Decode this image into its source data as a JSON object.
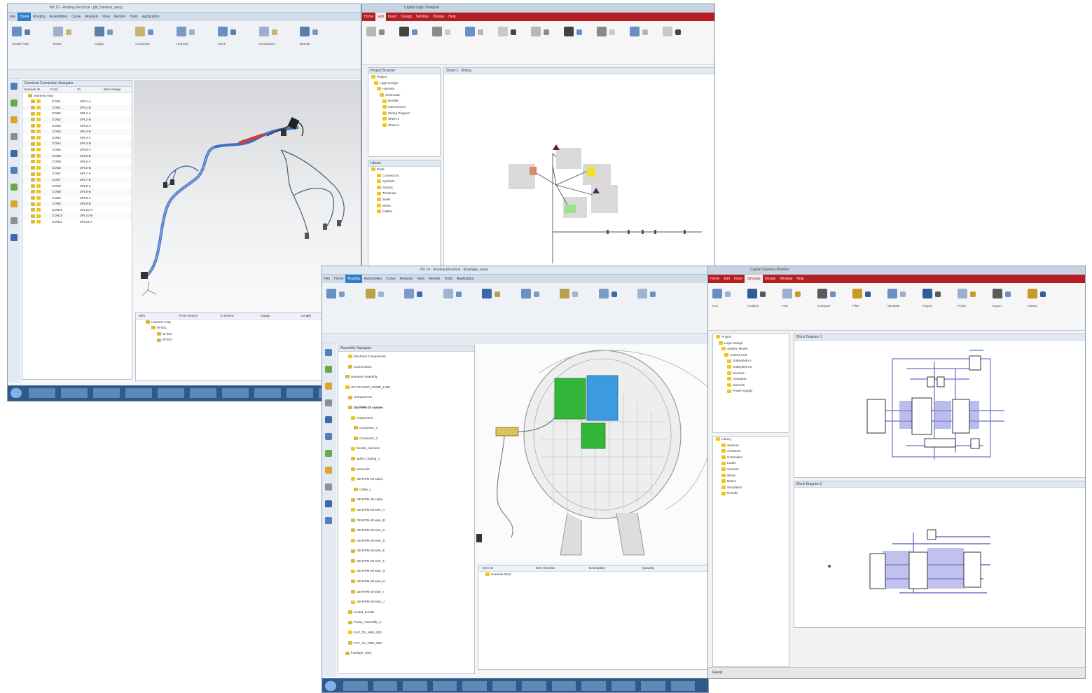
{
  "window1": {
    "title": "NX 10 - Routing Electrical - [db_harness_assy]",
    "tabs": [
      "File",
      "Home",
      "Routing",
      "Assemblies",
      "Curve",
      "Analysis",
      "View",
      "Render",
      "Tools",
      "Application"
    ],
    "active_tab": "Home",
    "ribbon_labels": [
      "Create Path",
      "Route",
      "Assign",
      "Connector",
      "Harness",
      "Stock",
      "Component",
      "Bundle"
    ],
    "navigator": {
      "title": "Electrical Connection Navigator",
      "columns": [
        "Harness ID",
        "From",
        "To",
        "Wire Gauge"
      ],
      "root": "Harness Assy",
      "rows": [
        {
          "from": "CON1",
          "to": "SPL1-A"
        },
        {
          "from": "CON1",
          "to": "SPL1-B"
        },
        {
          "from": "CON2",
          "to": "SPL2-A"
        },
        {
          "from": "CON2",
          "to": "SPL2-B"
        },
        {
          "from": "CON3",
          "to": "SPL3-A"
        },
        {
          "from": "CON3",
          "to": "SPL3-B"
        },
        {
          "from": "CON4",
          "to": "SPL4-A"
        },
        {
          "from": "CON4",
          "to": "SPL4-B"
        },
        {
          "from": "CON5",
          "to": "SPL5-A"
        },
        {
          "from": "CON5",
          "to": "SPL5-B"
        },
        {
          "from": "CON6",
          "to": "SPL6-A"
        },
        {
          "from": "CON6",
          "to": "SPL6-B"
        },
        {
          "from": "CON7",
          "to": "SPL7-A"
        },
        {
          "from": "CON7",
          "to": "SPL7-B"
        },
        {
          "from": "CON8",
          "to": "SPL8-A"
        },
        {
          "from": "CON8",
          "to": "SPL8-B"
        },
        {
          "from": "CON9",
          "to": "SPL9-A"
        },
        {
          "from": "CON9",
          "to": "SPL9-B"
        },
        {
          "from": "CON10",
          "to": "SPL10-A"
        },
        {
          "from": "CON10",
          "to": "SPL10-B"
        },
        {
          "from": "CON11",
          "to": "SPL11-A"
        }
      ]
    },
    "bottom_panel": {
      "columns": [
        "Wire",
        "From Device",
        "To Device",
        "Gauge",
        "Length"
      ],
      "rows": [
        "Harness Assy",
        "W-001",
        "W-002",
        "W-003"
      ]
    }
  },
  "window2": {
    "title": "Capital Logic Designer",
    "tabs": [
      "Home",
      "Edit",
      "Insert",
      "Design",
      "Window",
      "Display",
      "Help"
    ],
    "active_tab": "Edit",
    "tree_title": "Project Browser",
    "tree_items": [
      "Project",
      "Logic Design",
      "Harness",
      "Schematic",
      "Bundle",
      "Interconnect",
      "Wiring Diagram",
      "Sheet 1",
      "Sheet 2"
    ],
    "tree2_title": "Library",
    "tree2_items": [
      "Parts",
      "Connectors",
      "Symbols",
      "Splices",
      "Terminals",
      "Seals",
      "Wires",
      "Cables"
    ],
    "canvas_title": "Sheet 1 - Wiring"
  },
  "window3": {
    "title": "NX 10 - Routing Electrical - [fuselage_assy]",
    "tabs": [
      "File",
      "Home",
      "Routing",
      "Assemblies",
      "Curve",
      "Analysis",
      "View",
      "Render",
      "Tools",
      "Application"
    ],
    "active_tab": "Routing",
    "navigator": {
      "title": "Assembly Navigator",
      "rows": [
        "Electrical Components",
        "Connections",
        "Harness Assembly",
        "HFT-RH-EXT_PUMP_LINE",
        "Components",
        "GE-RPM-20 system",
        "Connectors",
        "Connector_1",
        "Connector_2",
        "bundle_harness",
        "splice_routing_1",
        "terminals",
        "GE-RPM-20-splice",
        "Cable_1",
        "GE-RPM-20-cable",
        "GE-RPM-20-wire_A",
        "GE-RPM-20-wire_B",
        "GE-RPM-20-wire_C",
        "GE-RPM-20-wire_D",
        "GE-RPM-20-wire_E",
        "GE-RPM-20-wire_F",
        "GE-RPM-20-wire_G",
        "GE-RPM-20-wire_H",
        "GE-RPM-20-wire_I",
        "GE-RPM-20-wire_J",
        "routed_bundle",
        "Pump_Assembly_2",
        "FAP_TS_HRN_002",
        "FAP_TS_HRN_003",
        "fuselage_assy"
      ]
    },
    "bottom_panel": {
      "columns": [
        "Item ID",
        "Item Revision",
        "Description",
        "Quantity"
      ],
      "rows": [
        "Harness Root"
      ]
    }
  },
  "window4": {
    "title": "Capital Systems Modeler",
    "tabs": [
      "Home",
      "Edit",
      "Insert",
      "Simulate",
      "Design",
      "Window",
      "Help"
    ],
    "active_tab": "Simulate",
    "ribbon_labels": [
      "Run",
      "Analyze",
      "Plot",
      "Compare",
      "Filter",
      "Simulate",
      "Report",
      "Probe",
      "Export",
      "Library"
    ],
    "tree_items": [
      "Project",
      "Logic Design",
      "System Model",
      "Control Unit",
      "Subsystem A",
      "Subsystem B",
      "Sensors",
      "Actuators",
      "Harness",
      "Power Supply"
    ],
    "tree2_items": [
      "Library",
      "Sensors",
      "Actuators",
      "Controllers",
      "Loads",
      "Sources",
      "Wires",
      "Buses",
      "Simulation",
      "Results"
    ],
    "top_canvas_title": "Block Diagram 1",
    "bottom_canvas_title": "Block Diagram 2",
    "status": "Ready"
  },
  "colors": {
    "nx_ribbon_active": "#2f7fc6",
    "capital_ribbon": "#b51d22",
    "taskbar": "#2d5a8a",
    "harness_blue": "#3f6fc0",
    "connector_green": "#33b63a",
    "connector_blue": "#3c9be0",
    "block_purple": "#6b6bcf"
  }
}
